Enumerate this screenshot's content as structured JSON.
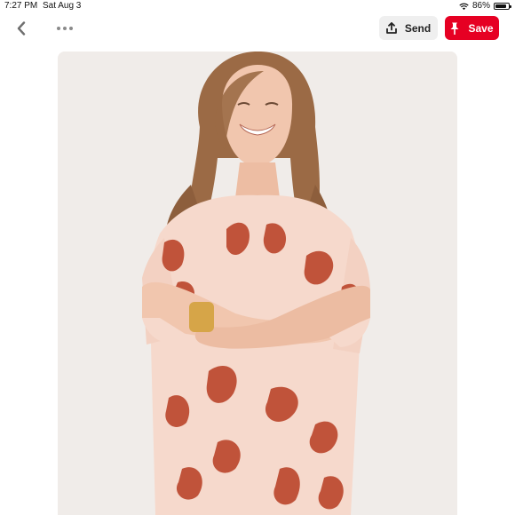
{
  "status_bar": {
    "time": "7:27 PM",
    "date": "Sat Aug 3",
    "battery_text": "86%",
    "battery_level": 0.86,
    "icons": [
      "wifi-icon",
      "battery-icon"
    ]
  },
  "toolbar": {
    "back_icon": "chevron-left-icon",
    "more_icon": "more-dots-icon",
    "send_label": "Send",
    "send_icon": "share-upload-icon",
    "save_label": "Save",
    "save_icon": "pin-icon"
  },
  "pin": {
    "image_subject": "woman in peach dress with rust floral print",
    "colors": {
      "background": "#f0ece9",
      "dress": "#f6d9cc",
      "print": "#c0533a",
      "hair": "#9b6a45",
      "skin": "#f1c6ae"
    }
  },
  "colors": {
    "accent": "#e60023",
    "send_bg": "#efefef"
  }
}
